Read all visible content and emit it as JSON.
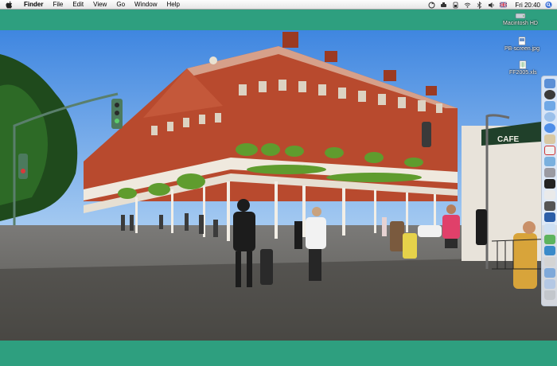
{
  "menubar": {
    "apple_icon": "apple-icon",
    "items": [
      "Finder",
      "File",
      "Edit",
      "View",
      "Go",
      "Window",
      "Help"
    ],
    "tray_icons": [
      "sync-icon",
      "volume-icon",
      "battery-icon",
      "wifi-icon",
      "bluetooth-icon",
      "speaker-icon",
      "flag-uk-icon"
    ],
    "clock": "Fri 20:40",
    "spotlight_icon": "spotlight-icon"
  },
  "desktop": {
    "icons": [
      {
        "label": "Macintosh HD",
        "icon": "hard-drive-icon"
      },
      {
        "label": "PB-screen.jpg",
        "icon": "image-file-icon"
      },
      {
        "label": "FF2005.xls",
        "icon": "spreadsheet-file-icon"
      }
    ],
    "background_color": "#2e9f7f"
  },
  "dock": {
    "items": [
      "finder-icon",
      "safari-icon",
      "mail-icon",
      "itunes-icon",
      "ichat-icon",
      "address-book-icon",
      "ical-icon",
      "iphoto-icon",
      "preferences-icon",
      "terminal-icon",
      "textedit-icon",
      "calculator-icon",
      "dictionary-icon",
      "preview-icon",
      "app-icon",
      "app-icon",
      "app-icon",
      "folder-icon",
      "documents-icon",
      "trash-icon"
    ]
  },
  "wallpaper": {
    "description_icon": "street-photo",
    "cafe_sign": "CAFE"
  }
}
